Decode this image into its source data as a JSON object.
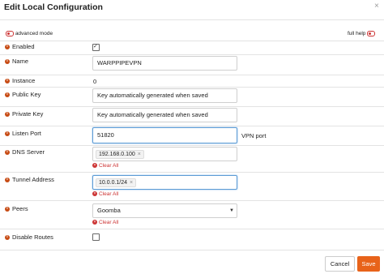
{
  "dialog": {
    "title": "Edit Local Configuration",
    "close_glyph": "×",
    "advanced_mode_label": "advanced mode",
    "full_help_label": "full help",
    "accent_color": "#e8631a"
  },
  "fields": {
    "enabled": {
      "label": "Enabled",
      "checked": true
    },
    "name": {
      "label": "Name",
      "value": "WARPPIPEVPN"
    },
    "instance": {
      "label": "Instance",
      "value": "0"
    },
    "public_key": {
      "label": "Public Key",
      "value": "Key automatically generated when saved"
    },
    "private_key": {
      "label": "Private Key",
      "value": "Key automatically generated when saved"
    },
    "listen_port": {
      "label": "Listen Port",
      "value": "51820",
      "hint": "VPN port"
    },
    "dns_server": {
      "label": "DNS Server",
      "tag": "192.168.0.100",
      "clear_label": "Clear All"
    },
    "tunnel_address": {
      "label": "Tunnel Address",
      "tag": "10.0.0.1/24",
      "clear_label": "Clear All"
    },
    "peers": {
      "label": "Peers",
      "selected": "Goomba",
      "clear_label": "Clear All"
    },
    "disable_routes": {
      "label": "Disable Routes",
      "checked": false
    }
  },
  "footer": {
    "cancel_label": "Cancel",
    "save_label": "Save"
  }
}
